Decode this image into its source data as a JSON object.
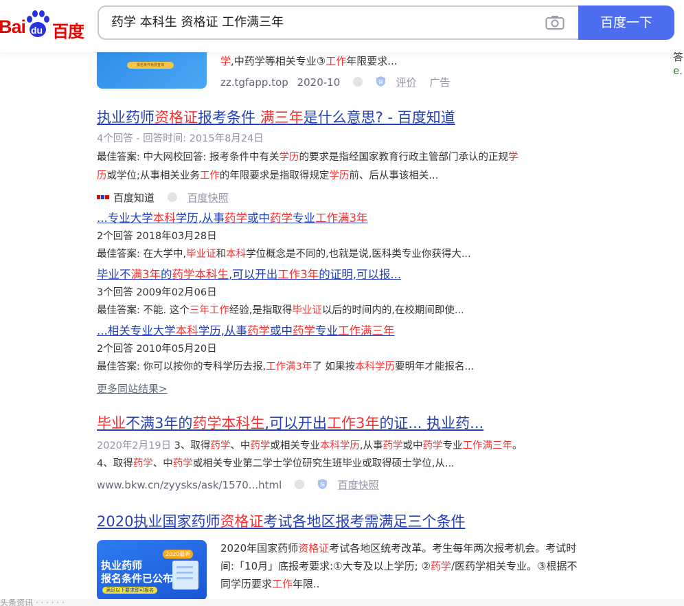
{
  "header": {
    "logo_bai": "Bai",
    "logo_du": "du",
    "logo_cn": "百度",
    "query": "药学 本科生 资格证 工作满三年",
    "search_button": "百度一下"
  },
  "ad": {
    "thumb_text": "报名条件免费查询",
    "desc_parts": [
      "学",
      ",中药学等相关专业③",
      "工作",
      "年限要求..."
    ],
    "domain": "zz.tgfapp.top",
    "date": "2020-10",
    "rate_label": "评价",
    "ad_label": "广告"
  },
  "right_edge": {
    "line1": "答",
    "line2": "e."
  },
  "result1": {
    "title_parts": [
      "执业药师",
      "资格证",
      "报考条件 ",
      "满三年",
      "是什么意思? - 百度知道"
    ],
    "meta": "4个回答 - 回答时间: 2015年8月24日",
    "answer_line1_parts": [
      "最佳答案: 中大网校回答: 报考条件中有关",
      "学历",
      "的要求是指经国家教育行政主管部门承认的正规",
      "学"
    ],
    "answer_line2_parts": [
      "历",
      "或学位;从事相关业务",
      "工作",
      "的年限要求是指取得规定",
      "学历",
      "前、后从事该相关..."
    ],
    "source_name": "百度知道",
    "snapshot_label": "百度快照",
    "sub1_parts": [
      "...专业大学",
      "本科",
      "学历,从事",
      "药学",
      "或中",
      "药学",
      "专业",
      "工作满3年"
    ],
    "sub1_meta": "2个回答   2018年03月28日",
    "sub1_answer_parts": [
      "最佳答案:  在大学中,",
      "毕业证",
      "和",
      "本科",
      "学位概念是不同的,也就是说,医科类专业你获得大..."
    ],
    "sub2_parts": [
      "毕业不",
      "满3年",
      "的",
      "药学本科生",
      ",可以开出",
      "工作3年",
      "的证明,可以报..."
    ],
    "sub2_meta": "3个回答   2009年02月06日",
    "sub2_answer_parts": [
      "最佳答案:  不能. 这个",
      "三年工作",
      "经验,是指取得",
      "毕业证",
      "以后的时间内的,在校期间即使..."
    ],
    "sub3_parts": [
      "...相关专业大学",
      "本科",
      "学历,从事",
      "药学",
      "或中",
      "药学",
      "专业",
      "工作满三年"
    ],
    "sub3_meta": "2个回答   2010年05月20日",
    "sub3_answer_parts": [
      "最佳答案:  你可以按你的专科学历去报,",
      "工作满3年",
      "了 如果按",
      "本科学历",
      "要明年才能报名..."
    ],
    "more_link": "更多同站结果>"
  },
  "result2": {
    "title_parts": [
      "毕业",
      "不满3年",
      "的",
      "药学本科生",
      ",可以开出",
      "工作3年",
      "的证...  执业药..."
    ],
    "line1_parts": [
      "2020年2月19日",
      " 3、取得",
      "药学",
      "、中",
      "药学",
      "或相关专业",
      "本科学历",
      ",从事",
      "药学",
      "或中",
      "药学",
      "专业",
      "工作满三年",
      "。"
    ],
    "line2_parts": [
      "4、取得",
      "药学",
      "、中",
      "药学",
      "或相关专业第二学士学位研究生班毕业或取得硕士学位,从..."
    ],
    "url": "www.bkw.cn/zyysks/ask/1570...html",
    "snapshot_label": "百度快照"
  },
  "result3": {
    "title_parts": [
      "2020执业国家药师",
      "资格证",
      "考试各地区报考需满足三个条件"
    ],
    "thumb_title": "执业药师\n报名条件已公布",
    "thumb_tag": "2020最新",
    "thumb_bar": "满足以下要求即可报名",
    "para_parts": [
      "2020年国家药师",
      "资格证",
      "考试各地区统考改革。考生每年两次报考机会。考试时间:「10月」底报考要求:①大专及以上学历; ②",
      "药学",
      "/医药学相关专业。③根据不同学历要求",
      "工作",
      "年限.."
    ]
  },
  "bottom_bar": "头条资讯    ·   ·   ·   ·   ·   ·"
}
